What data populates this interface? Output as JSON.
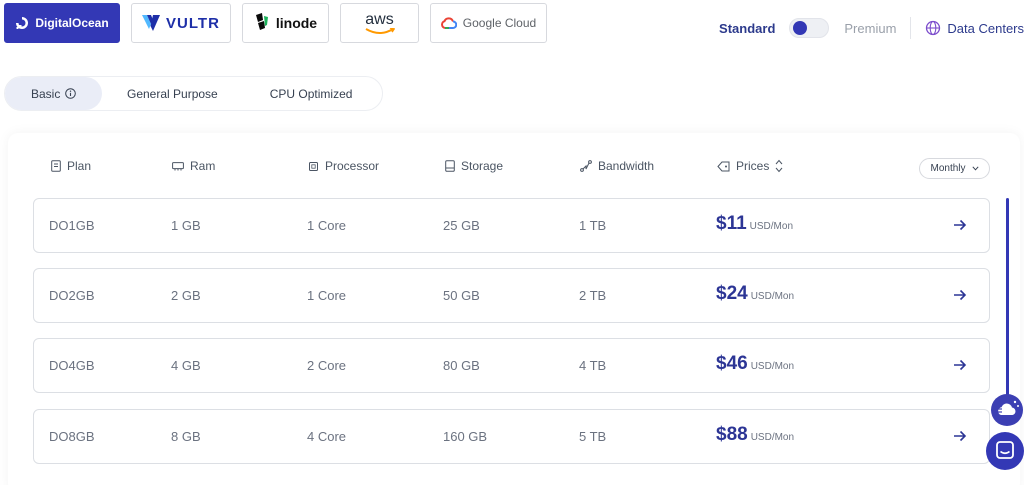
{
  "providers": [
    {
      "name": "DigitalOcean",
      "active": true
    },
    {
      "name": "VULTR",
      "active": false
    },
    {
      "name": "linode",
      "active": false
    },
    {
      "name": "aws",
      "active": false
    },
    {
      "name": "Google Cloud",
      "active": false
    }
  ],
  "plan_switch": {
    "standard_label": "Standard",
    "premium_label": "Premium",
    "selected": "Standard"
  },
  "data_centers_label": "Data Centers",
  "categories": [
    {
      "label": "Basic",
      "active": true,
      "icon": "info-icon"
    },
    {
      "label": "General Purpose",
      "active": false
    },
    {
      "label": "CPU Optimized",
      "active": false
    }
  ],
  "table": {
    "headers": {
      "plan": "Plan",
      "ram": "Ram",
      "processor": "Processor",
      "storage": "Storage",
      "bandwidth": "Bandwidth",
      "prices": "Prices"
    },
    "billing_period": "Monthly",
    "rows": [
      {
        "plan": "DO1GB",
        "ram": "1 GB",
        "processor": "1 Core",
        "storage": "25 GB",
        "bandwidth": "1 TB",
        "price": "$11",
        "unit": "USD/Mon"
      },
      {
        "plan": "DO2GB",
        "ram": "2 GB",
        "processor": "1 Core",
        "storage": "50 GB",
        "bandwidth": "2 TB",
        "price": "$24",
        "unit": "USD/Mon"
      },
      {
        "plan": "DO4GB",
        "ram": "4 GB",
        "processor": "2 Core",
        "storage": "80 GB",
        "bandwidth": "4 TB",
        "price": "$46",
        "unit": "USD/Mon"
      },
      {
        "plan": "DO8GB",
        "ram": "8 GB",
        "processor": "4 Core",
        "storage": "160 GB",
        "bandwidth": "5 TB",
        "price": "$88",
        "unit": "USD/Mon"
      }
    ]
  },
  "colors": {
    "accent": "#3338b5",
    "price": "#2c3595",
    "text_muted": "#6b7280"
  }
}
